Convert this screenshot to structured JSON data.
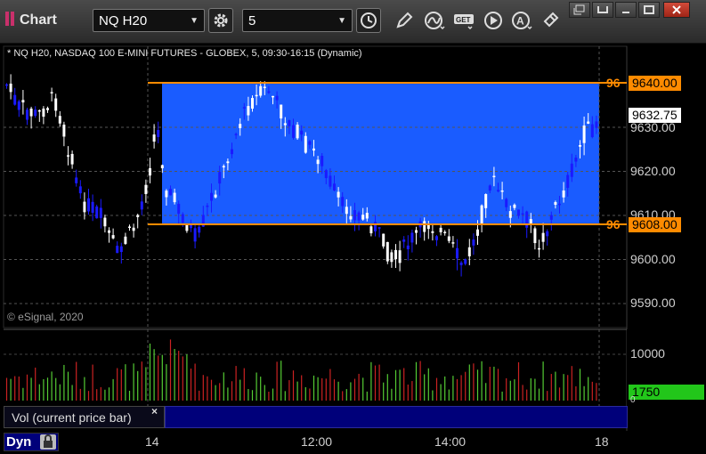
{
  "window": {
    "title": "Chart",
    "symbol_value": "NQ H20",
    "interval_value": "5"
  },
  "chart": {
    "info_line": "* NQ H20, NASDAQ 100 E-MINI FUTURES - GLOBEX, 5, 09:30-16:15 (Dynamic)",
    "copyright": "© eSignal, 2020",
    "price_ticks": [
      "9630.00",
      "9620.00",
      "9610.00",
      "9600.00",
      "9590.00"
    ],
    "upper_line_label": "9640.00",
    "lower_line_label": "9608.00",
    "last_price_label": "9632.75",
    "line_prefix": "96"
  },
  "volume": {
    "study_label": "Vol (current price bar)",
    "close_glyph": "×",
    "tick": "10000",
    "last_value": "1750",
    "zero": "0"
  },
  "time_axis": {
    "ticks": [
      "14",
      "12:00",
      "14:00",
      "18"
    ],
    "dyn_label": "Dyn"
  },
  "colors": {
    "up_candle": "#ffffff",
    "down_candle": "#1a1aff",
    "zone_fill": "#1a5cff",
    "line": "#ff8b00",
    "vol_up": "#55cc33",
    "vol_down": "#cc2222"
  },
  "icons": [
    "gear-icon",
    "clock-icon",
    "pencil-icon",
    "curve-icon",
    "get-icon",
    "play-icon",
    "alert-icon",
    "share-icon"
  ]
}
